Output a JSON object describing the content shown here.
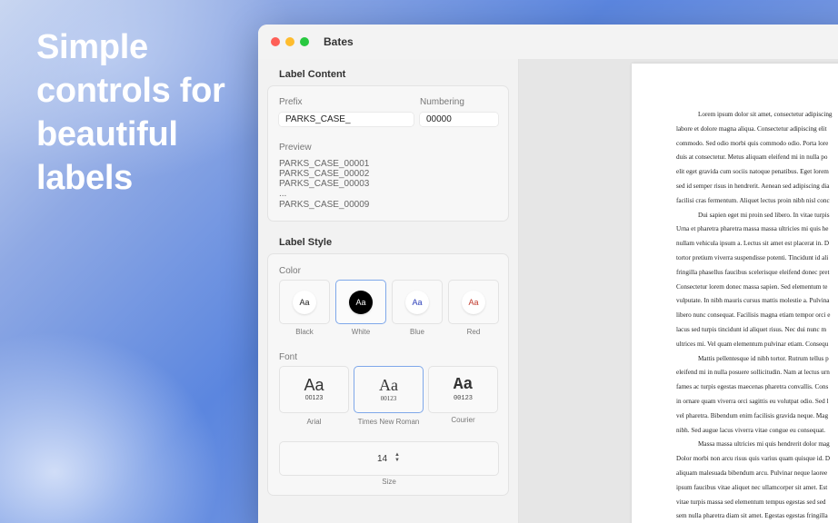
{
  "hero": {
    "lines": [
      "Simple",
      "controls for",
      "beautiful",
      "labels"
    ]
  },
  "window": {
    "title": "Bates"
  },
  "label_content": {
    "title": "Label Content",
    "prefix_label": "Prefix",
    "prefix_value": "PARKS_CASE_",
    "numbering_label": "Numbering",
    "numbering_value": "00000",
    "preview_label": "Preview",
    "preview_lines": [
      "PARKS_CASE_00001",
      "PARKS_CASE_00002",
      "PARKS_CASE_00003",
      "...",
      "PARKS_CASE_00009"
    ]
  },
  "label_style": {
    "title": "Label Style",
    "color_label": "Color",
    "colors": [
      {
        "name": "Black",
        "sample": "Aa",
        "fg": "#222222",
        "bg": "#ffffff",
        "selected": false
      },
      {
        "name": "White",
        "sample": "Aa",
        "fg": "#ffffff",
        "bg": "#000000",
        "selected": true
      },
      {
        "name": "Blue",
        "sample": "Aa",
        "fg": "#2a3db8",
        "bg": "#ffffff",
        "selected": false
      },
      {
        "name": "Red",
        "sample": "Aa",
        "fg": "#c0392b",
        "bg": "#ffffff",
        "selected": false
      }
    ],
    "font_label": "Font",
    "fonts": [
      {
        "name": "Arial",
        "sample": "Aa",
        "number": "00123",
        "selected": false
      },
      {
        "name": "Times New Roman",
        "sample": "Aa",
        "number": "00123",
        "selected": true
      },
      {
        "name": "Courier",
        "sample": "Aa",
        "number": "00123",
        "selected": false
      }
    ],
    "size_value": "14",
    "size_label": "Size",
    "stepper_up": "▲",
    "stepper_down": "▼"
  },
  "document": {
    "lines": [
      {
        "text": "Lorem ipsum dolor sit amet, consectetur adipiscing",
        "indent": true
      },
      {
        "text": "labore et dolore magna aliqua. Consectetur adipiscing elit",
        "indent": false
      },
      {
        "text": "commodo. Sed odio morbi quis commodo odio. Porta lore",
        "indent": false
      },
      {
        "text": "duis at consectetur. Metus aliquam eleifend mi in nulla po",
        "indent": false
      },
      {
        "text": "elit eget gravida cum sociis natoque penatibus. Eget lorem",
        "indent": false
      },
      {
        "text": "sed id semper risus in hendrerit. Aenean sed adipiscing dia",
        "indent": false
      },
      {
        "text": "facilisi cras fermentum. Aliquet lectus proin nibh nisl conc",
        "indent": false
      },
      {
        "text": "Dui sapien eget mi proin sed libero. In vitae turpis",
        "indent": true
      },
      {
        "text": "Urna et pharetra pharetra massa massa ultricies mi quis he",
        "indent": false
      },
      {
        "text": "nullam vehicula ipsum a. Lectus sit amet est placerat in. D",
        "indent": false
      },
      {
        "text": "tortor pretium viverra suspendisse potenti. Tincidunt id ali",
        "indent": false
      },
      {
        "text": "fringilla phasellus faucibus scelerisque eleifend donec pret",
        "indent": false
      },
      {
        "text": "Consectetur lorem donec massa sapien. Sed elementum te",
        "indent": false
      },
      {
        "text": "vulputate. In nibh mauris cursus mattis molestie a. Pulvina",
        "indent": false
      },
      {
        "text": "libero nunc consequat. Facilisis magna etiam tempor orci e",
        "indent": false
      },
      {
        "text": "lacus sed turpis tincidunt id aliquet risus. Nec dui nunc m",
        "indent": false
      },
      {
        "text": "ultrices mi. Vel quam elementum pulvinar etiam. Consequ",
        "indent": false
      },
      {
        "text": "Mattis pellentesque id nibh tortor. Rutrum tellus p",
        "indent": true
      },
      {
        "text": "eleifend mi in nulla posuere sollicitudin. Nam at lectus urn",
        "indent": false
      },
      {
        "text": "fames ac turpis egestas maecenas pharetra convallis. Cons",
        "indent": false
      },
      {
        "text": "in ornare quam viverra orci sagittis eu volutpat odio. Sed l",
        "indent": false
      },
      {
        "text": "vel pharetra. Bibendum enim facilisis gravida neque. Mag",
        "indent": false
      },
      {
        "text": "nibh. Sed augue lacus viverra vitae congue eu consequat.",
        "indent": false
      },
      {
        "text": "Massa massa ultricies mi quis hendrerit dolor mag",
        "indent": true
      },
      {
        "text": "Dolor morbi non arcu risus quis varius quam quisque id. D",
        "indent": false
      },
      {
        "text": "aliquam malesuada bibendum arcu. Pulvinar neque laoree",
        "indent": false
      },
      {
        "text": "ipsum faucibus vitae aliquet nec ullamcorper sit amet. Est",
        "indent": false
      },
      {
        "text": "vitae turpis massa sed elementum tempus egestas sed sed",
        "indent": false
      },
      {
        "text": "sem nulla pharetra diam sit amet. Egestas egestas fringilla",
        "indent": false
      }
    ]
  }
}
